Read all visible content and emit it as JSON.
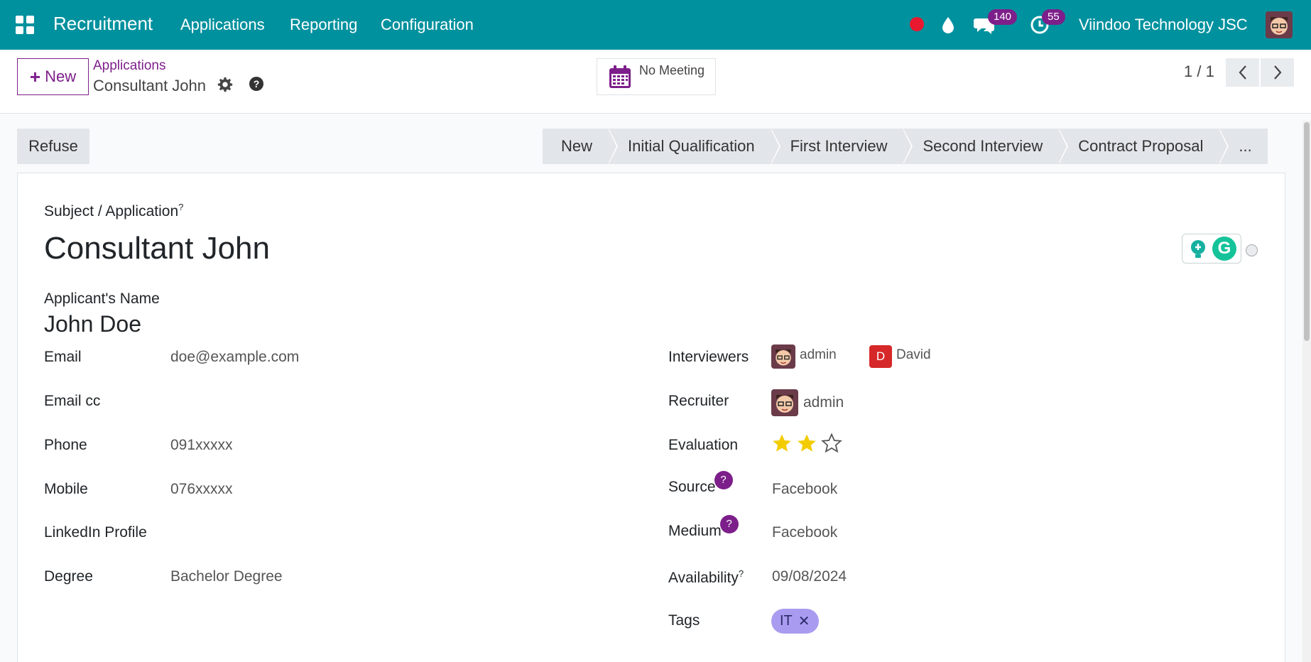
{
  "navbar": {
    "app_title": "Recruitment",
    "menus": [
      "Applications",
      "Reporting",
      "Configuration"
    ],
    "messages_badge": "140",
    "activities_badge": "55",
    "company": "Viindoo Technology JSC"
  },
  "control": {
    "new_label": "New",
    "breadcrumb_parent": "Applications",
    "breadcrumb_current": "Consultant John",
    "meeting_label": "No Meeting",
    "pager": "1 / 1"
  },
  "statusbar": {
    "refuse_label": "Refuse",
    "stages": [
      "New",
      "Initial Qualification",
      "First Interview",
      "Second Interview",
      "Contract Proposal",
      "..."
    ]
  },
  "form": {
    "subject_label": "Subject / Application",
    "subject_sup": "?",
    "subject_value": "Consultant John",
    "applicant_label": "Applicant's Name",
    "applicant_value": "John Doe",
    "left": {
      "email_label": "Email",
      "email_value": "doe@example.com",
      "emailcc_label": "Email cc",
      "phone_label": "Phone",
      "phone_value": "091xxxxx",
      "mobile_label": "Mobile",
      "mobile_value": "076xxxxx",
      "linkedin_label": "LinkedIn Profile",
      "degree_label": "Degree",
      "degree_value": "Bachelor Degree"
    },
    "right": {
      "interviewers_label": "Interviewers",
      "interviewer_1": "admin",
      "interviewer_2": "David",
      "interviewer_2_initial": "D",
      "recruiter_label": "Recruiter",
      "recruiter_value": "admin",
      "evaluation_label": "Evaluation",
      "evaluation_stars": 2,
      "evaluation_max": 3,
      "source_label": "Source",
      "source_value": "Facebook",
      "medium_label": "Medium",
      "medium_value": "Facebook",
      "help_mark": "?",
      "availability_label": "Availability",
      "availability_sup": "?",
      "availability_value": "09/08/2024",
      "tags_label": "Tags",
      "tag_1": "IT",
      "tag_remove": "✕"
    }
  },
  "colors": {
    "navbar": "#00919e",
    "brand": "#7d1f8a",
    "star": "#f3cc00",
    "tag": "#a99cf0",
    "avatar_d": "#d62828"
  }
}
